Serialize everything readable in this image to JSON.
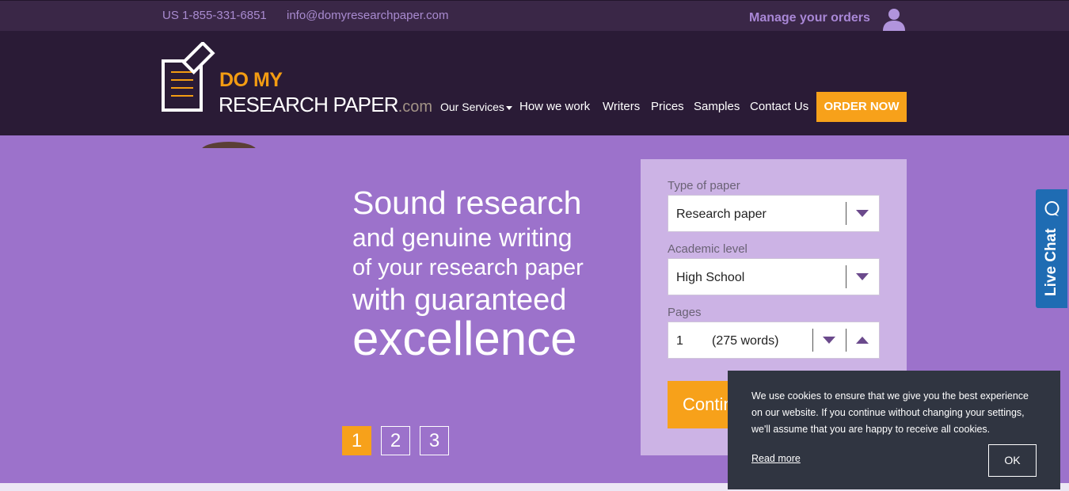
{
  "topbar": {
    "phone": "US 1-855-331-6851",
    "email": "info@domyresearchpaper.com",
    "manage_orders": "Manage your orders",
    "user_icon": "user-icon"
  },
  "logo": {
    "line1": "DO MY",
    "line2": "RESEARCH PAPER",
    "suffix": ".com",
    "icon": "document-pencil-icon"
  },
  "nav": {
    "items": [
      {
        "label": "Our Services",
        "has_dropdown": true
      },
      {
        "label": "How we work"
      },
      {
        "label": "Writers"
      },
      {
        "label": "Prices"
      },
      {
        "label": "Samples"
      },
      {
        "label": "Contact Us"
      }
    ],
    "order_button": "ORDER NOW"
  },
  "hero": {
    "line1": "Sound research",
    "line2": "and genuine writing",
    "line3": "of your research paper",
    "line4": "with guaranteed",
    "line5": "excellence",
    "slides": [
      "1",
      "2",
      "3"
    ],
    "active_slide": "1"
  },
  "order_form": {
    "type_label": "Type of paper",
    "type_value": "Research paper",
    "level_label": "Academic level",
    "level_value": "High School",
    "pages_label": "Pages",
    "pages_value": "1",
    "pages_words": "(275 words)",
    "continue_label": "Continue"
  },
  "live_chat": {
    "label": "Live Chat",
    "icon": "chat-bubble-icon"
  },
  "cookie": {
    "text": "We use cookies to ensure that we give you the best experience on our website. If you continue without changing your settings, we'll assume that you are happy to receive all cookies.",
    "read_more": "Read more",
    "ok": "OK"
  },
  "colors": {
    "accent": "#f7a11a",
    "header_bg": "#2a1b36",
    "hero_bg": "#9c72cb",
    "chat_blue": "#1f6cb3"
  }
}
